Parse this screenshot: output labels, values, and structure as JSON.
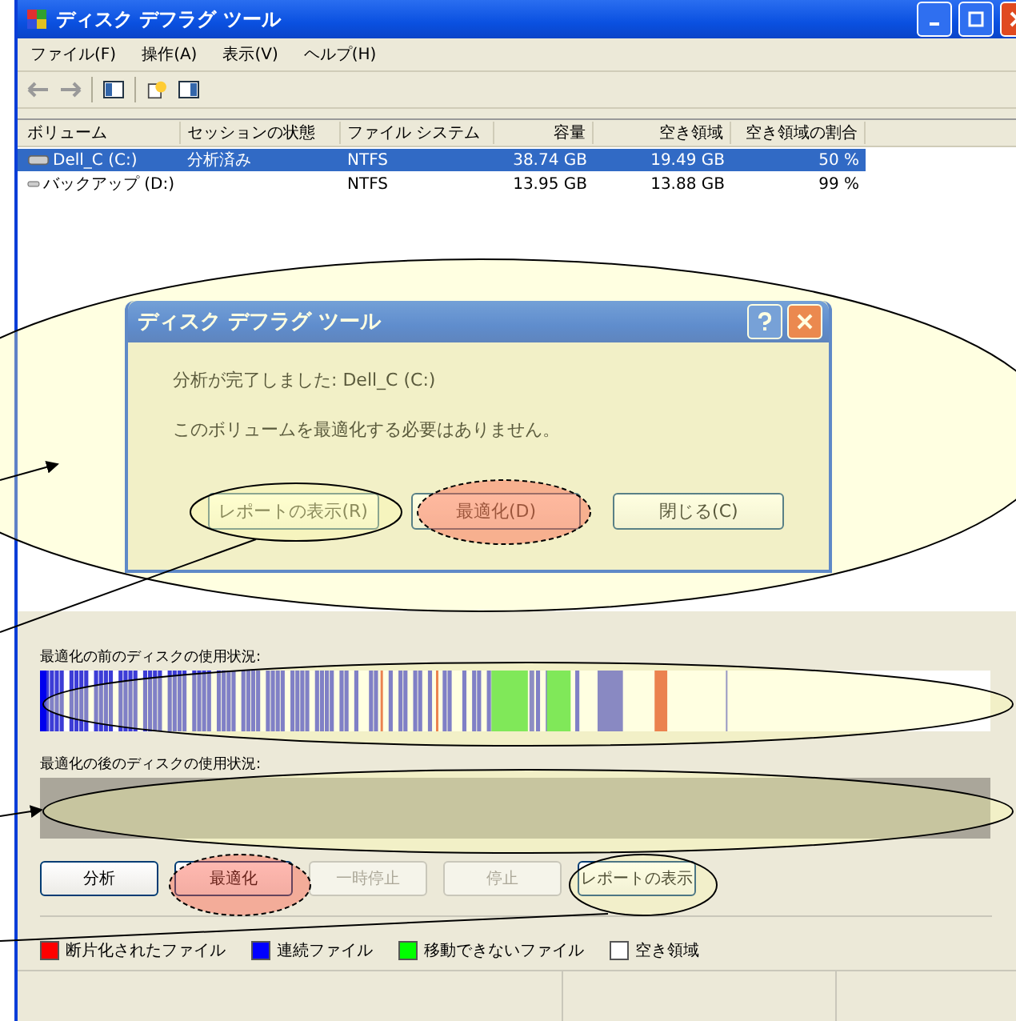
{
  "window": {
    "title": "ディスク デフラグ ツール"
  },
  "menu": [
    "ファイル(F)",
    "操作(A)",
    "表示(V)",
    "ヘルプ(H)"
  ],
  "table": {
    "columns": [
      "ボリューム",
      "セッションの状態",
      "ファイル システム",
      "容量",
      "空き領域",
      "空き領域の割合"
    ],
    "rows": [
      {
        "cells": [
          "Dell_C (C:)",
          "分析済み",
          "NTFS",
          "38.74 GB",
          "19.49 GB",
          "50 %"
        ],
        "selected": true
      },
      {
        "cells": [
          "バックアップ (D:)",
          "",
          "NTFS",
          "13.95 GB",
          "13.88 GB",
          "99 %"
        ],
        "selected": false
      }
    ]
  },
  "dialog": {
    "title": "ディスク デフラグ ツール",
    "lines": [
      "分析が完了しました: Dell_C (C:)",
      "このボリュームを最適化する必要はありません。"
    ],
    "buttons": [
      "レポートの表示(R)",
      "最適化(D)",
      "閉じる(C)"
    ]
  },
  "before_label": "最適化の前のディスクの使用状況:",
  "after_label": "最適化の後のディスクの使用状況:",
  "buttons": [
    {
      "label": "分析",
      "disabled": false
    },
    {
      "label": "最適化",
      "disabled": false
    },
    {
      "label": "一時停止",
      "disabled": true
    },
    {
      "label": "停止",
      "disabled": true
    },
    {
      "label": "レポートの表示",
      "disabled": false
    }
  ],
  "legend": [
    {
      "label": "断片化されたファイル",
      "color": "#ff0000"
    },
    {
      "label": "連続ファイル",
      "color": "#0000ff"
    },
    {
      "label": "移動できないファイル",
      "color": "#00ff00"
    },
    {
      "label": "空き領域",
      "color": "#ffffff"
    }
  ]
}
